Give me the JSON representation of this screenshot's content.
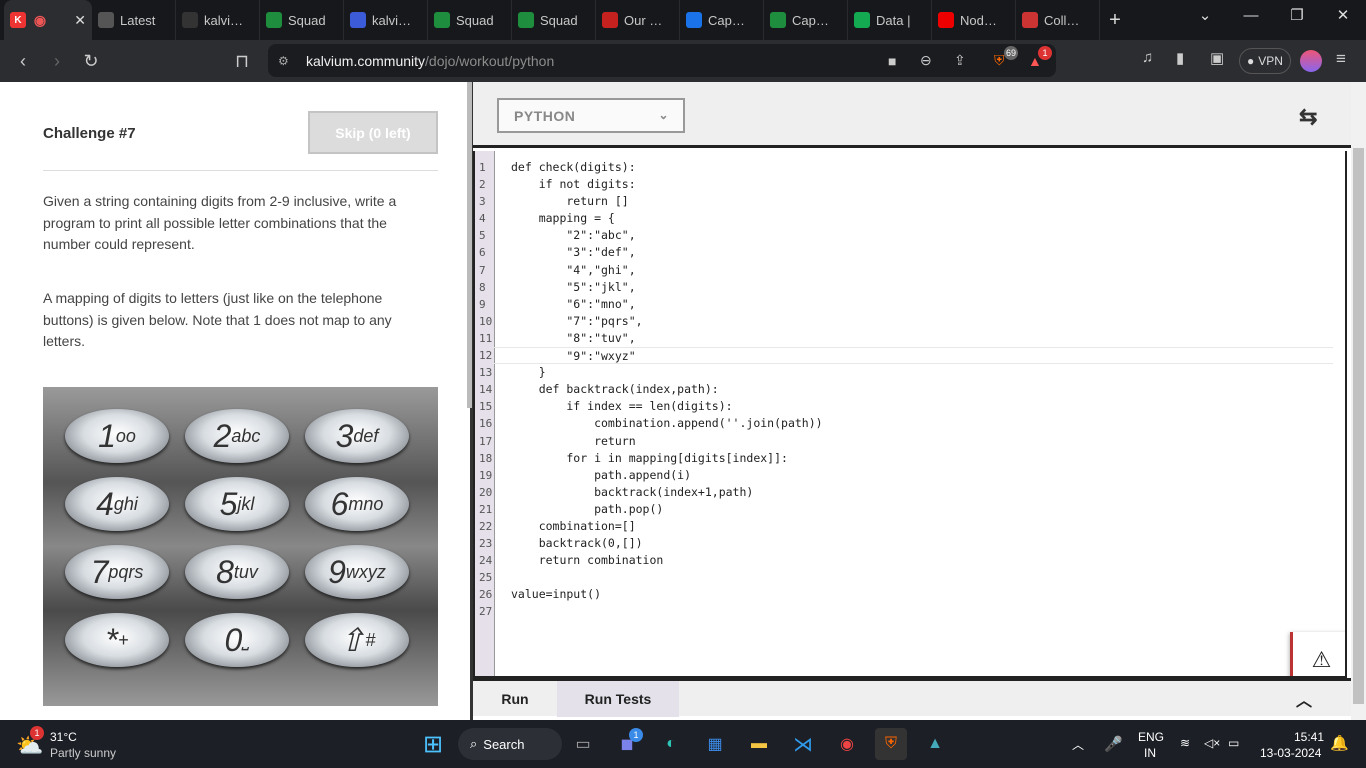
{
  "browser": {
    "tabs": [
      {
        "label": "Latest",
        "icon": "globe-icon",
        "color": "#555"
      },
      {
        "label": "kalvium",
        "icon": "github-icon",
        "color": "#333"
      },
      {
        "label": "Squad",
        "icon": "sheets-icon",
        "color": "#1e8e3e"
      },
      {
        "label": "kalvium",
        "icon": "calendar-icon",
        "color": "#3b5bd9"
      },
      {
        "label": "Squad",
        "icon": "sheets-icon",
        "color": "#1e8e3e"
      },
      {
        "label": "Squad",
        "icon": "sheets-icon",
        "color": "#1e8e3e"
      },
      {
        "label": "Our Lea",
        "icon": "gmail-icon",
        "color": "#c5221f"
      },
      {
        "label": "Capsto",
        "icon": "calendar-icon",
        "color": "#1a73e8"
      },
      {
        "label": "Capsto",
        "icon": "sheets-icon",
        "color": "#1e8e3e"
      },
      {
        "label": "Data |",
        "icon": "leaf-icon",
        "color": "#13aa52"
      },
      {
        "label": "Node.J",
        "icon": "youtube-icon",
        "color": "#e00"
      },
      {
        "label": "Collabo",
        "icon": "brave-icon",
        "color": "#c33"
      }
    ],
    "url_host": "kalvium.community",
    "url_path": "/dojo/workout/python",
    "vpn_label": "VPN",
    "shield_badge": "69",
    "rewards_badge": "1"
  },
  "challenge": {
    "title": "Challenge #7",
    "skip_label": "Skip (0 left)",
    "para1": "Given a string containing digits from 2-9 inclusive, write a program to print all possible letter combinations that the number could represent.",
    "para2": "A mapping of digits to letters (just like on the telephone buttons) is given below. Note that 1 does not map to any letters.",
    "keys": [
      {
        "digit": "1",
        "letters": "oo"
      },
      {
        "digit": "2",
        "letters": "abc"
      },
      {
        "digit": "3",
        "letters": "def"
      },
      {
        "digit": "4",
        "letters": "ghi"
      },
      {
        "digit": "5",
        "letters": "jkl"
      },
      {
        "digit": "6",
        "letters": "mno"
      },
      {
        "digit": "7",
        "letters": "pqrs"
      },
      {
        "digit": "8",
        "letters": "tuv"
      },
      {
        "digit": "9",
        "letters": "wxyz"
      },
      {
        "digit": "*",
        "letters": "+"
      },
      {
        "digit": "0",
        "letters": "⎵"
      },
      {
        "digit": "⇧",
        "letters": "#"
      }
    ]
  },
  "editor": {
    "language": "PYTHON",
    "code_lines": [
      "def check(digits):",
      "    if not digits:",
      "        return []",
      "    mapping = {",
      "        \"2\":\"abc\",",
      "        \"3\":\"def\",",
      "        \"4\",\"ghi\",",
      "        \"5\":\"jkl\",",
      "        \"6\":\"mno\",",
      "        \"7\":\"pqrs\",",
      "        \"8\":\"tuv\",",
      "        \"9\":\"wxyz\"",
      "    }",
      "    def backtrack(index,path):",
      "        if index == len(digits):",
      "            combination.append(''.join(path))",
      "            return",
      "        for i in mapping[digits[index]]:",
      "            path.append(i)",
      "            backtrack(index+1,path)",
      "            path.pop()",
      "    combination=[]",
      "    backtrack(0,[])",
      "    return combination",
      "",
      "value=input()",
      ""
    ],
    "run_label": "Run",
    "run_tests_label": "Run Tests"
  },
  "taskbar": {
    "weather_temp": "31°C",
    "weather_desc": "Partly sunny",
    "weather_badge": "1",
    "search_label": "Search",
    "lang_top": "ENG",
    "lang_bottom": "IN",
    "time": "15:41",
    "date": "13-03-2024",
    "teams_badge": "1"
  }
}
